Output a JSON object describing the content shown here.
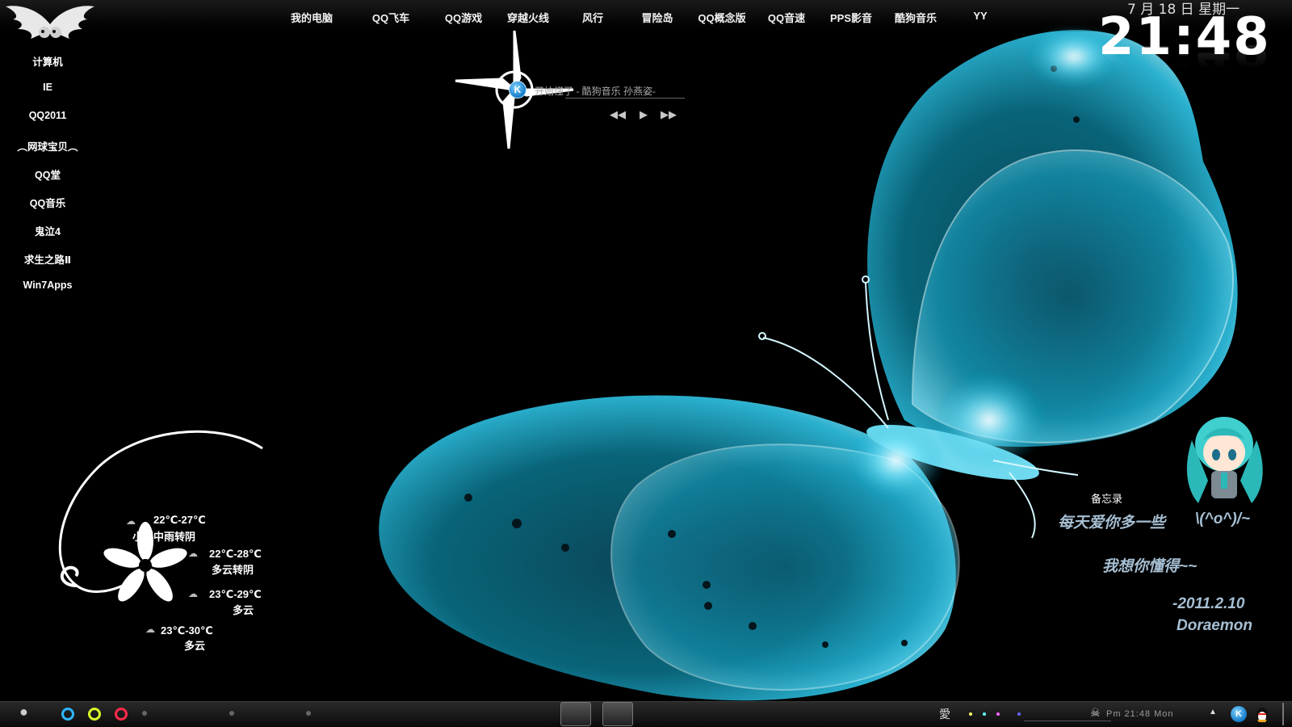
{
  "top_dock": {
    "items": [
      "我的电脑",
      "QQ飞车",
      "QQ游戏",
      "穿越火线",
      "风行",
      "冒险岛",
      "QQ概念版",
      "QQ音速",
      "PPS影音",
      "酷狗音乐",
      "YY"
    ]
  },
  "clock": {
    "date": "7 月 18 日  星期一",
    "time": "21:48"
  },
  "left_icons": {
    "items": [
      "计算机",
      "IE",
      "QQ2011",
      "︵网球宝贝︵",
      "QQ堂",
      "QQ音乐",
      "鬼泣4",
      "求生之路Ⅱ",
      "Win7Apps"
    ]
  },
  "music": {
    "app_icon_letter": "K",
    "song": "开始懂了 - 酷狗音乐  孙燕姿-",
    "prev": "◀◀",
    "play": "▶",
    "next": "▶▶"
  },
  "weather": {
    "today": {
      "temp": "22℃-27℃",
      "desc": "小到中雨转阴"
    },
    "day2": {
      "temp": "22℃-28℃",
      "desc": "多云转阴"
    },
    "day3": {
      "temp": "23℃-29℃",
      "desc": "多云"
    },
    "day4": {
      "temp": "23℃-30℃",
      "desc": "多云"
    }
  },
  "memo": {
    "title": "备忘录",
    "line1": "每天爱你多一些",
    "line1_emoticon": "\\(^o^)/~",
    "line2": "我想你懂得~~",
    "date": "-2011.2.10",
    "author": "Doraemon"
  },
  "taskbar": {
    "ring_colors": [
      "#2fb6ff",
      "#d8ff2a",
      "#ff2a4a"
    ],
    "tray_char": "愛",
    "dot_colors": [
      "#ffff66",
      "#66ffff",
      "#ff66ff",
      "#6666ff"
    ],
    "tray_clock": "Pm  21:48  Mon",
    "tray_arrow": "▲",
    "tray_k": "K"
  },
  "colors": {
    "accent_cyan": "#3fd8ff",
    "background": "#000000"
  }
}
